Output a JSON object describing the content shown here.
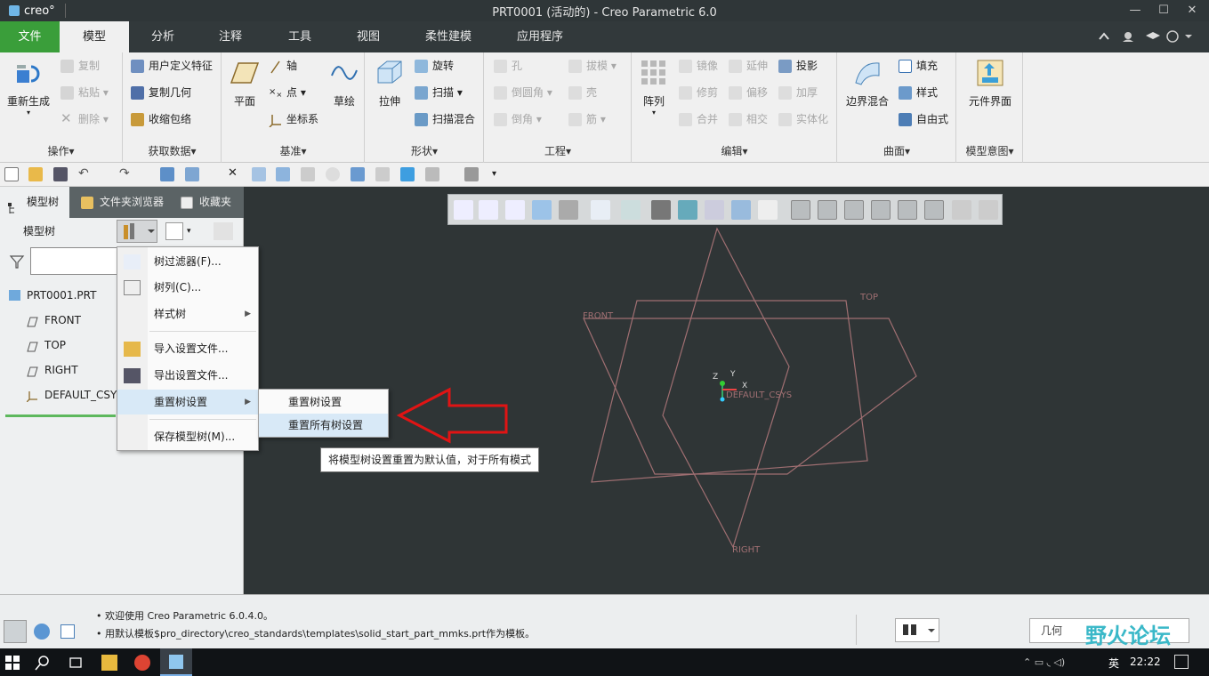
{
  "window": {
    "app_logo": "creo°",
    "title": "PRT0001 (活动的) - Creo Parametric 6.0",
    "minimize": "—",
    "maximize": "☐",
    "close": "✕"
  },
  "ribbon_tabs": {
    "file": "文件",
    "items": [
      "模型",
      "分析",
      "注释",
      "工具",
      "视图",
      "柔性建模",
      "应用程序"
    ]
  },
  "ribbon": {
    "ops": {
      "regen": "重新生成",
      "copy": "复制",
      "paste": "粘贴",
      "delete": "删除",
      "label": "操作▾"
    },
    "getdata": {
      "udf": "用户定义特征",
      "copygeom": "复制几何",
      "shrinkwrap": "收缩包络",
      "label": "获取数据▾"
    },
    "datum": {
      "plane": "平面",
      "axis": "轴",
      "point": "点",
      "csys": "坐标系",
      "sketch": "草绘",
      "label": "基准▾"
    },
    "shape": {
      "extrude": "拉伸",
      "revolve": "旋转",
      "sweep": "扫描",
      "swept_blend": "扫描混合",
      "label": "形状▾"
    },
    "eng": {
      "hole": "孔",
      "round": "倒圆角",
      "chamfer": "倒角",
      "draft": "拔模",
      "shell": "壳",
      "rib": "筋",
      "label": "工程▾"
    },
    "edit": {
      "pattern": "阵列",
      "mirror": "镜像",
      "trim": "修剪",
      "merge": "合并",
      "extend": "延伸",
      "offset": "偏移",
      "intersect": "相交",
      "project": "投影",
      "thicken": "加厚",
      "solidify": "实体化",
      "label": "编辑▾"
    },
    "surface": {
      "boundary": "边界混合",
      "fill": "填充",
      "style": "样式",
      "freestyle": "自由式",
      "label": "曲面▾"
    },
    "intent": {
      "component_interface": "元件界面",
      "label": "模型意图▾"
    }
  },
  "panel_tabs": {
    "tree": "模型树",
    "browser": "文件夹浏览器",
    "favorites": "收藏夹"
  },
  "tree": {
    "header": "模型树",
    "search_value": "",
    "items": [
      "PRT0001.PRT",
      "FRONT",
      "TOP",
      "RIGHT",
      "DEFAULT_CSY"
    ]
  },
  "menu": {
    "filter": "树过滤器(F)...",
    "columns": "树列(C)...",
    "style_tree": "样式树",
    "import_cfg": "导入设置文件...",
    "export_cfg": "导出设置文件...",
    "reset": "重置树设置",
    "save_tree": "保存模型树(M)..."
  },
  "submenu": {
    "reset": "重置树设置",
    "reset_all": "重置所有树设置"
  },
  "tooltip": "将模型树设置重置为默认值，对于所有模式",
  "viewport": {
    "labels": {
      "front": "FRONT",
      "top": "TOP",
      "right": "RIGHT",
      "csys": "DEFAULT_CSYS",
      "x": "X",
      "y": "Y",
      "z": "Z"
    }
  },
  "status": {
    "msg1": "• 欢迎使用 Creo Parametric 6.0.4.0。",
    "msg2": "• 用默认模板$pro_directory\\creo_standards\\templates\\solid_start_part_mmks.prt作为模板。",
    "filter_value": "几何",
    "watermark": "野火论坛"
  },
  "taskbar": {
    "ime": "英",
    "time": "22:22"
  },
  "colors": {
    "ribbon_bg": "#f0f0f0",
    "file_tab": "#3a9e3a",
    "viewport_bg": "#2f3536",
    "datum_plane": "#a06f72",
    "menu_highlight": "#d8e9f7",
    "arrow": "#e01414"
  }
}
